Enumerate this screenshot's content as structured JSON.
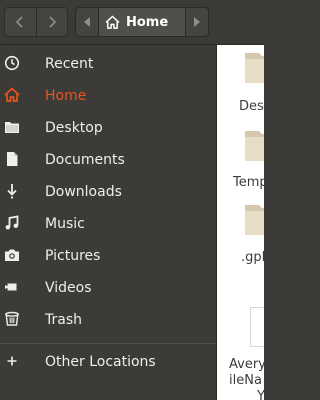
{
  "header": {
    "back_icon": "chevron-left-icon",
    "forward_icon": "chevron-right-icon",
    "path_left_icon": "path-scroll-left-icon",
    "path_right_icon": "path-scroll-right-icon",
    "current_location": "Home",
    "current_location_icon": "home-icon"
  },
  "sidebar": {
    "items": [
      {
        "label": "Recent",
        "icon": "clock-icon",
        "active": false
      },
      {
        "label": "Home",
        "icon": "home-icon",
        "active": true
      },
      {
        "label": "Desktop",
        "icon": "folder-icon",
        "active": false
      },
      {
        "label": "Documents",
        "icon": "document-icon",
        "active": false
      },
      {
        "label": "Downloads",
        "icon": "download-icon",
        "active": false
      },
      {
        "label": "Music",
        "icon": "music-note-icon",
        "active": false
      },
      {
        "label": "Pictures",
        "icon": "camera-icon",
        "active": false
      },
      {
        "label": "Videos",
        "icon": "video-camera-icon",
        "active": false
      },
      {
        "label": "Trash",
        "icon": "trash-icon",
        "active": false
      },
      {
        "label": "Other Locations",
        "icon": "plus-icon",
        "active": false
      }
    ]
  },
  "files": [
    {
      "label": "Desk",
      "icon": "folder-icon"
    },
    {
      "label": "Templ",
      "icon": "folder-icon"
    },
    {
      "label": ".gpl",
      "icon": "folder-icon"
    },
    {
      "label": "Avery",
      "label2": "ileNa",
      "label3": "Y",
      "icon": "document-icon"
    }
  ],
  "colors": {
    "accent": "#e95420",
    "sidebar_bg": "#3c3b37",
    "folder": "#d5c7ad"
  }
}
